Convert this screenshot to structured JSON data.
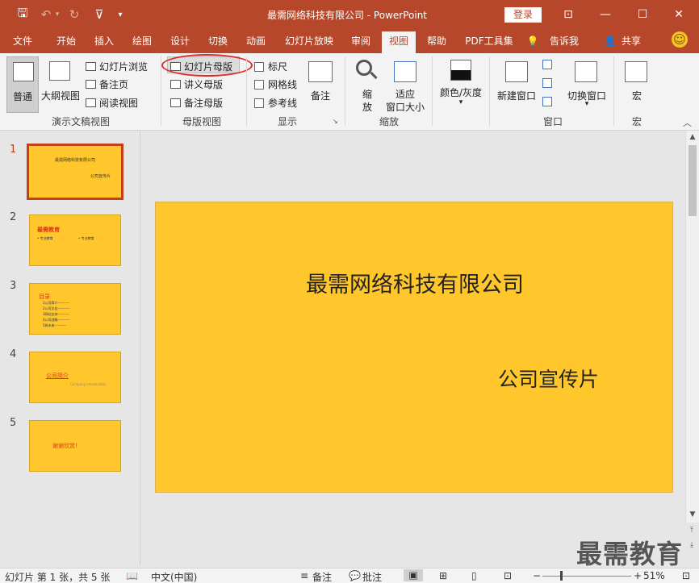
{
  "titlebar": {
    "title": "最需网络科技有限公司  -  PowerPoint",
    "login": "登录",
    "icons": [
      "save-icon",
      "undo-icon",
      "redo-icon",
      "from-beginning-icon",
      "customize-qat-icon"
    ],
    "glyphs": {
      "save": "🖫",
      "undo": "↶",
      "undo_drop": "▾",
      "redo": "↻",
      "start": "⊽",
      "customize": "▾",
      "ribbon_display": "⊡",
      "minimize": "—",
      "maximize": "☐",
      "close": "✕"
    }
  },
  "tabs": [
    "文件",
    "开始",
    "插入",
    "绘图",
    "设计",
    "切换",
    "动画",
    "幻灯片放映",
    "审阅",
    "视图",
    "帮助",
    "PDF工具集",
    "告诉我",
    "共享"
  ],
  "tab_icons": {
    "tell_me": "💡",
    "share": "👤",
    "smiley": "☺"
  },
  "ribbon": {
    "presentation_views": {
      "label": "演示文稿视图",
      "normal": "普通",
      "outline": "大纲视图",
      "sorter": "幻灯片浏览",
      "notes_page": "备注页",
      "reading": "阅读视图"
    },
    "master_views": {
      "label": "母版视图",
      "slide_master": "幻灯片母版",
      "handout_master": "讲义母版",
      "notes_master": "备注母版"
    },
    "show": {
      "label": "显示",
      "ruler": "标尺",
      "gridlines": "网格线",
      "guides": "参考线",
      "notes": "备注",
      "launcher": "↘"
    },
    "zoom": {
      "label": "缩放",
      "zoom_line1": "缩",
      "zoom_line2": "放",
      "fit_line1": "适应",
      "fit_line2": "窗口大小"
    },
    "color": {
      "label": "颜色/灰度",
      "arrow": "▾"
    },
    "window": {
      "label": "窗口",
      "new_window": "新建窗口",
      "switch_windows": "切换窗口",
      "arrow": "▾"
    },
    "macros": {
      "label": "宏",
      "macros": "宏"
    },
    "collapse": "︿"
  },
  "thumbnails": [
    {
      "num": "1",
      "line1": "最需网络科技有限公司",
      "line2": "公司宣传片"
    },
    {
      "num": "2",
      "line1": "最需教育",
      "line2": "• 专业教育",
      "line3": "• 专业教育"
    },
    {
      "num": "3",
      "line1": "目录",
      "items": [
        "1公司简介----------",
        "2公司文化----------",
        "3网站支持----------",
        "4公司战略----------",
        "5致未来----------"
      ]
    },
    {
      "num": "4",
      "line1": "公司简介",
      "line2": "Company introduction"
    },
    {
      "num": "5",
      "line1": "谢谢欣赏！"
    }
  ],
  "slide": {
    "title": "最需网络科技有限公司",
    "subtitle": "公司宣传片"
  },
  "scroll_glyphs": {
    "up": "▲",
    "down": "▼",
    "prev": "⤒",
    "next": "⤓"
  },
  "watermark": "最需教育",
  "statusbar": {
    "slide_info": "幻灯片 第 1 张，共 5 张",
    "language": "中文(中国)",
    "notes": "备注",
    "comments": "批注",
    "zoom": "51%",
    "zoom_level": 0.51,
    "glyphs": {
      "spell": "📖",
      "notes": "≡",
      "comments": "💬",
      "normal": "▣",
      "sorter": "⊞",
      "reading": "▯",
      "slideshow": "⊡",
      "minus": "−",
      "plus": "+",
      "fit": "⊡"
    }
  },
  "colors": {
    "accent": "#b7472a",
    "slide_bg": "#ffc72c",
    "selection": "#c43e1c"
  }
}
